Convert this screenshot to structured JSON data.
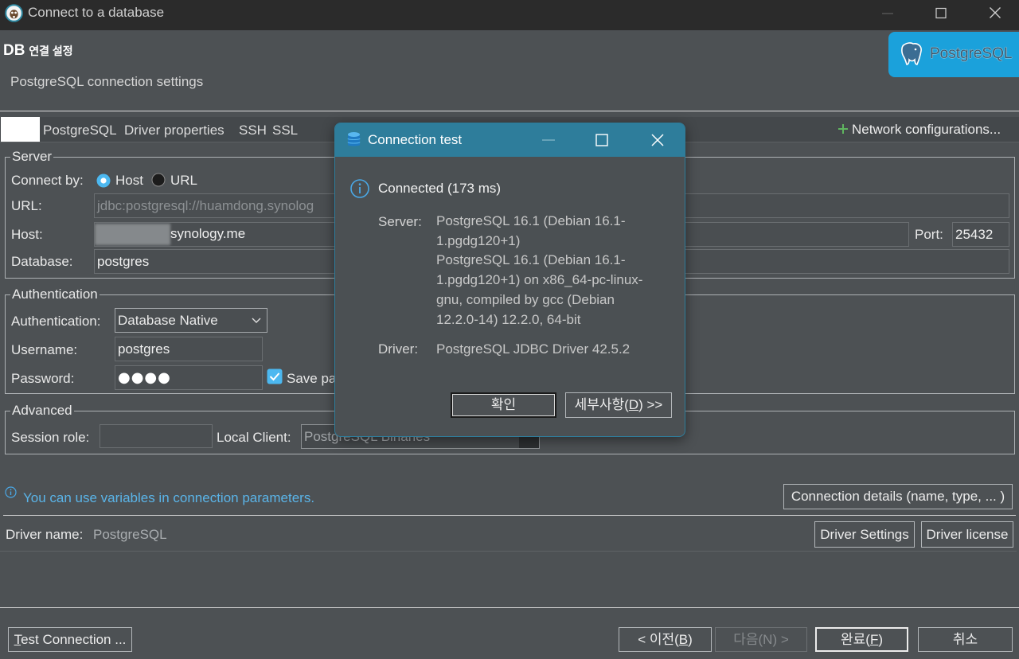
{
  "window": {
    "title": "Connect to a database"
  },
  "header": {
    "title_db": "DB",
    "title_rest": "연결 설정",
    "subtitle": "PostgreSQL connection settings",
    "logo_text": "PostgreSQL"
  },
  "tabs": {
    "items": [
      "PostgreSQL",
      "Driver properties",
      "SSH",
      "SSL"
    ],
    "network_configurations": "Network configurations..."
  },
  "server": {
    "group_label": "Server",
    "connect_by_label": "Connect by:",
    "connect_by_options": [
      {
        "label": "Host",
        "selected": true
      },
      {
        "label": "URL",
        "selected": false
      }
    ],
    "url_label": "URL:",
    "url_value": "jdbc:postgresql://huamdong.synolog",
    "host_label": "Host:",
    "host_value": "synology.me",
    "port_label": "Port:",
    "port_value": "25432",
    "database_label": "Database:",
    "database_value": "postgres"
  },
  "authentication": {
    "group_label": "Authentication",
    "auth_label": "Authentication:",
    "auth_value": "Database Native",
    "username_label": "Username:",
    "username_value": "postgres",
    "password_label": "Password:",
    "password_mask": "●●●●",
    "save_password_label": "Save pa",
    "save_password_checked": true
  },
  "advanced": {
    "group_label": "Advanced",
    "session_role_label": "Session role:",
    "local_client_label": "Local Client:",
    "local_client_value": "PostgreSQL Binaries"
  },
  "info": {
    "icon": "info-icon",
    "text": "You can use variables in connection parameters."
  },
  "connection_details_button": "Connection details (name, type, ... )",
  "driver": {
    "name_label": "Driver name:",
    "name_value": "PostgreSQL",
    "settings_button": "Driver Settings",
    "license_button": "Driver license"
  },
  "footer": {
    "test_connection": {
      "key": "T",
      "rest": "est Connection ..."
    },
    "back": {
      "pre": "< 이전(",
      "key": "B",
      "post": ")"
    },
    "next": {
      "label": "다음(N) >",
      "enabled": false
    },
    "finish": {
      "pre": "완료(",
      "key": "F",
      "post": ")"
    },
    "cancel": "취소"
  },
  "dialog": {
    "title": "Connection test",
    "status": "Connected (173 ms)",
    "server_label": "Server:",
    "server_lines": [
      "PostgreSQL 16.1 (Debian 16.1-",
      "1.pgdg120+1)",
      "PostgreSQL 16.1 (Debian 16.1-",
      "1.pgdg120+1) on x86_64-pc-linux-",
      "gnu, compiled by gcc (Debian",
      "12.2.0-14) 12.2.0, 64-bit"
    ],
    "driver_label": "Driver:",
    "driver_value": "PostgreSQL JDBC Driver 42.5.2",
    "ok_button": "확인",
    "details_button": {
      "pre": "세부사항(",
      "key": "D",
      "post": ") >>"
    }
  },
  "colors": {
    "background": "#4d5154",
    "titlebar": "#2b2b2b",
    "dialog_accent": "#2e7d9b",
    "logo_background": "#1ba1db",
    "info_text": "#5ab4e8",
    "selection_blue": "#4cb8f0",
    "plus_green": "#5fb55f"
  }
}
